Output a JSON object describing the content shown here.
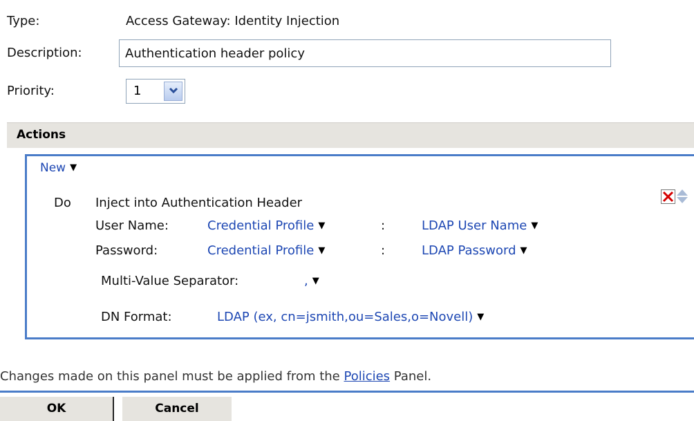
{
  "form": {
    "type_label": "Type:",
    "type_value": "Access Gateway: Identity Injection",
    "description_label": "Description:",
    "description_value": "Authentication header policy",
    "priority_label": "Priority:",
    "priority_value": "1"
  },
  "actions": {
    "title": "Actions",
    "new_label": "New",
    "do_label": "Do",
    "action_title": "Inject into Authentication Header",
    "user_name_label": "User Name:",
    "user_name_source": "Credential Profile",
    "user_name_value": "LDAP User Name",
    "password_label": "Password:",
    "password_source": "Credential Profile",
    "password_value": "LDAP Password",
    "colon": ":",
    "separator_label": "Multi-Value Separator:",
    "separator_value": ",",
    "dn_label": "DN Format:",
    "dn_value": "LDAP (ex, cn=jsmith,ou=Sales,o=Novell)"
  },
  "footer": {
    "note_before": "Changes made on this panel must be applied from the ",
    "note_link": "Policies",
    "note_after": " Panel.",
    "ok_label": "OK",
    "cancel_label": "Cancel"
  },
  "icons": {
    "dropdown": "caret-down-icon",
    "delete": "delete-x-icon",
    "move": "move-up-down-icon"
  },
  "colors": {
    "link": "#1d47b3",
    "accent_border": "#4a7cc8",
    "header_bg": "#e6e4df",
    "delete_red": "#d40000"
  }
}
